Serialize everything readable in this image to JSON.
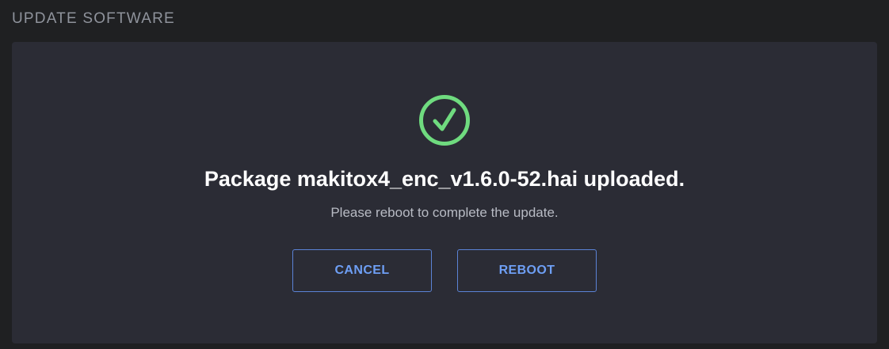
{
  "section": {
    "title": "UPDATE SOFTWARE"
  },
  "dialog": {
    "icon": "check-circle-icon",
    "icon_color": "#6fdb7f",
    "title": "Package makitox4_enc_v1.6.0-52.hai uploaded.",
    "subtitle": "Please reboot to complete the update.",
    "buttons": {
      "cancel_label": "CANCEL",
      "reboot_label": "REBOOT"
    },
    "accent_color": "#6e9ff5"
  }
}
